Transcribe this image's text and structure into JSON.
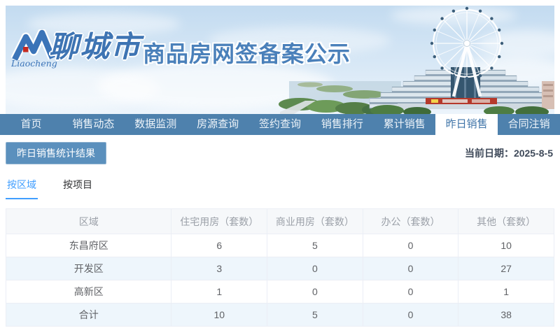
{
  "banner": {
    "logo_script": "Liaocheng",
    "city": "聊城市",
    "title": "商品房网签备案公示"
  },
  "nav": {
    "items": [
      "首页",
      "销售动态",
      "数据监测",
      "房源查询",
      "签约查询",
      "销售排行",
      "累计销售",
      "昨日销售",
      "合同注销"
    ],
    "active_index": 7,
    "active_label": "昨日销售"
  },
  "toolbar": {
    "result_button": "昨日销售统计结果",
    "date_label": "当前日期：",
    "date_value": "2025-8-5"
  },
  "view_tabs": {
    "items": [
      "按区域",
      "按项目"
    ],
    "active_index": 0,
    "active_label": "按区域"
  },
  "table": {
    "headers": [
      "区域",
      "住宅用房（套数）",
      "商业用房（套数）",
      "办公（套数）",
      "其他（套数）"
    ],
    "rows": [
      [
        "东昌府区",
        "6",
        "5",
        "0",
        "10"
      ],
      [
        "开发区",
        "3",
        "0",
        "0",
        "27"
      ],
      [
        "高新区",
        "1",
        "0",
        "0",
        "1"
      ],
      [
        "合计",
        "10",
        "5",
        "0",
        "38"
      ]
    ]
  },
  "colors": {
    "nav_bg": "#4e81ad",
    "nav_active_text": "#3f74a8",
    "button_bg": "#5b90bd",
    "tab_accent": "#409eff",
    "stripe_row": "#eef6fc",
    "title_blue": "#4a80ba",
    "logo_blue": "#3b74b8",
    "logo_red": "#c52a21"
  }
}
